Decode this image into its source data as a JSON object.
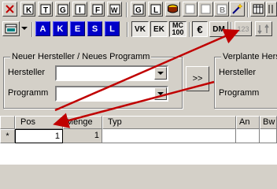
{
  "toolbar1": {
    "icons": [
      "delete-icon",
      "form-k-icon",
      "form-t-icon",
      "form-g-icon",
      "form-i-icon",
      "form-f-icon",
      "form-w-icon",
      "form-g2-icon",
      "form-l-icon",
      "box-icon",
      "blank-icon",
      "blank2-icon",
      "form-b-icon",
      "wand-icon",
      "table-icon",
      "columns-icon"
    ]
  },
  "toolbar2": {
    "letters": [
      "A",
      "K",
      "E",
      "S",
      "L"
    ],
    "toggles": [
      "VK",
      "EK",
      "MC",
      "100",
      "€",
      "DM",
      "123"
    ]
  },
  "group_new": {
    "title": "Neuer Hersteller / Neues Programm",
    "hersteller_label": "Hersteller",
    "programm_label": "Programm",
    "hersteller_value": "",
    "programm_value": ""
  },
  "transfer_button": ">>",
  "group_planned": {
    "title": "Verplante Herst",
    "hersteller_label": "Hersteller",
    "programm_label": "Programm"
  },
  "grid": {
    "columns": [
      "Pos",
      "Menge",
      "Typ",
      "An",
      "Bw"
    ],
    "row": {
      "pos": "1",
      "menge": "1",
      "typ": "",
      "an": "",
      "bw": ""
    },
    "new_row_marker": "*"
  }
}
